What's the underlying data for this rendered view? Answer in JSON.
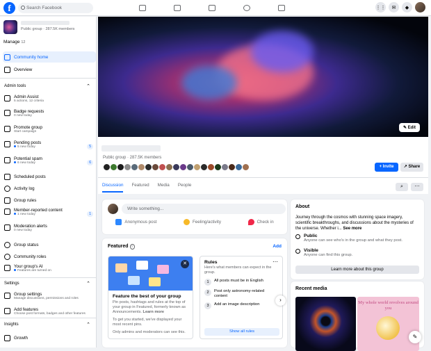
{
  "search": {
    "placeholder": "Search Facebook"
  },
  "group": {
    "meta": "Public group · 287.5K members",
    "privacy": "Public group · 287.5K members"
  },
  "sidebar": {
    "manage_label": "Manage",
    "manage_count": "12",
    "nav": [
      {
        "label": "Community home"
      },
      {
        "label": "Overview"
      }
    ],
    "admin_tools_title": "Admin tools",
    "tools": [
      {
        "label": "Admin Assist",
        "sub": "5 actions, 12 criteria"
      },
      {
        "label": "Badge requests",
        "sub": "0 new today"
      },
      {
        "label": "Promote group",
        "sub": "Start campaign"
      },
      {
        "label": "Pending posts",
        "sub": "5 new today",
        "count": "5"
      },
      {
        "label": "Potential spam",
        "sub": "6 new today",
        "count": "6"
      },
      {
        "label": "Scheduled posts",
        "sub": ""
      },
      {
        "label": "Activity log",
        "sub": ""
      },
      {
        "label": "Group rules",
        "sub": ""
      },
      {
        "label": "Member-reported content",
        "sub": "1 new today",
        "count": "1"
      },
      {
        "label": "Moderation alerts",
        "sub": "0 new today"
      },
      {
        "label": "Group status",
        "sub": ""
      },
      {
        "label": "Community roles",
        "sub": ""
      },
      {
        "label": "Your group's AI",
        "sub": "Features are turned on"
      }
    ],
    "settings_title": "Settings",
    "settings": [
      {
        "label": "Group settings",
        "sub": "Manage discussions, permissions and roles"
      },
      {
        "label": "Add features",
        "sub": "Choose post formats, badges and other features"
      }
    ],
    "insights_title": "Insights",
    "insights": [
      {
        "label": "Growth"
      }
    ]
  },
  "cover": {
    "edit_label": "Edit"
  },
  "header": {
    "invite_label": "Invite",
    "share_label": "Share",
    "tabs": [
      "Discussion",
      "Featured",
      "Media",
      "People"
    ]
  },
  "composer": {
    "placeholder": "Write something...",
    "actions": [
      "Anonymous post",
      "Feeling/activity",
      "Check in"
    ]
  },
  "featured": {
    "title": "Featured",
    "add_label": "Add",
    "promo_title": "Feature the best of your group",
    "promo_text": "Pin posts, hashtags and rules at the top of your group in Featured, formerly known as Announcements.",
    "promo_learn": "Learn more",
    "promo_text2": "To get you started, we've displayed your most recent pins.",
    "promo_text3": "Only admins and moderators can see this.",
    "rules_title": "Rules",
    "rules_sub": "Here's what members can expect in the group.",
    "rules": [
      {
        "num": "1",
        "text": "All posts must be in English"
      },
      {
        "num": "2",
        "text": "Post only astronomy-related content"
      },
      {
        "num": "3",
        "text": "Add an image description"
      }
    ],
    "show_all_label": "Show all rules"
  },
  "about": {
    "title": "About",
    "text": "Journey through the cosmos with stunning space imagery, scientific breakthroughs, and discussions about the mysteries of the universe. Whether i...",
    "see_more": "See more",
    "public_title": "Public",
    "public_text": "Anyone can see who's in the group and what they post.",
    "visible_title": "Visible",
    "visible_text": "Anyone can find this group.",
    "learn_label": "Learn more about this group"
  },
  "media": {
    "title": "Recent media",
    "img2_text": "My whole world revolves around you"
  }
}
